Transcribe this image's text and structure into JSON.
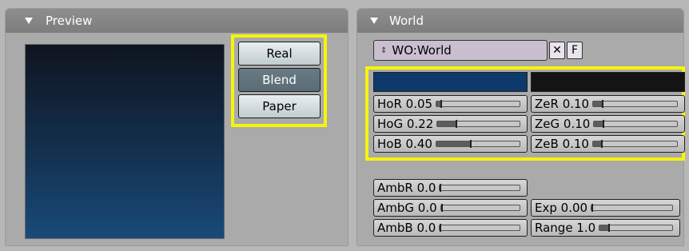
{
  "preview": {
    "title": "Preview",
    "buttons": [
      "Real",
      "Blend",
      "Paper"
    ],
    "active_button": "Blend"
  },
  "world": {
    "title": "World",
    "name_field": "WO:World",
    "unlink_label": "✕",
    "fake_user_label": "F",
    "horizon_color": "#0d3a6b",
    "zenith_color": "#141414",
    "horizon": [
      {
        "label": "HoR 0.05",
        "value": 0.05
      },
      {
        "label": "HoG 0.22",
        "value": 0.22
      },
      {
        "label": "HoB 0.40",
        "value": 0.4
      }
    ],
    "zenith": [
      {
        "label": "ZeR 0.10",
        "value": 0.1
      },
      {
        "label": "ZeG 0.10",
        "value": 0.1
      },
      {
        "label": "ZeB 0.10",
        "value": 0.1
      }
    ],
    "ambient": [
      {
        "label": "AmbR 0.0",
        "value": 0.0
      },
      {
        "label": "AmbG 0.0",
        "value": 0.0
      },
      {
        "label": "AmbB 0.0",
        "value": 0.0
      }
    ],
    "exposure": {
      "label": "Exp 0.00",
      "value": 0.0
    },
    "range": {
      "label": "Range 1.0",
      "value": 0.04
    }
  },
  "colors": {
    "highlight": "#f6f40a",
    "header": "#7d7d7d"
  }
}
